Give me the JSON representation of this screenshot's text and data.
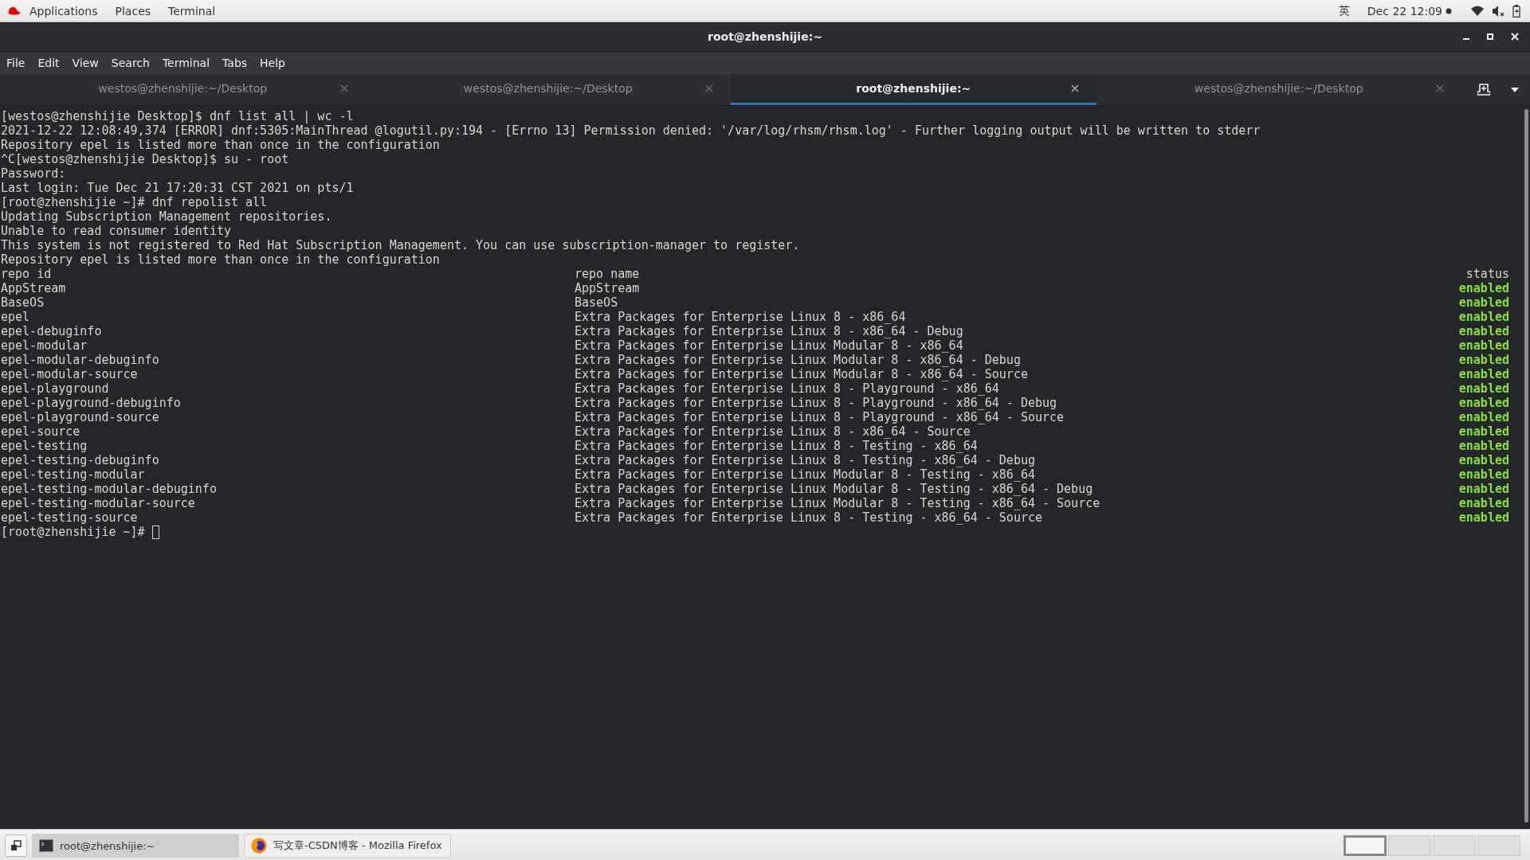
{
  "top_bar": {
    "menus": [
      "Applications",
      "Places",
      "Terminal"
    ],
    "input_method": "英",
    "clock": "Dec 22  12:09"
  },
  "window": {
    "title": "root@zhenshijie:~",
    "menu": [
      "File",
      "Edit",
      "View",
      "Search",
      "Terminal",
      "Tabs",
      "Help"
    ],
    "tabs": [
      {
        "label": "westos@zhenshijie:~/Desktop",
        "selected": false
      },
      {
        "label": "westos@zhenshijie:~/Desktop",
        "selected": false
      },
      {
        "label": "root@zhenshijie:~",
        "selected": true
      },
      {
        "label": "westos@zhenshijie:~/Desktop",
        "selected": false
      }
    ],
    "terminal": {
      "lines": [
        "[westos@zhenshijie Desktop]$ dnf list all | wc -l",
        "2021-12-22 12:08:49,374 [ERROR] dnf:5305:MainThread @logutil.py:194 - [Errno 13] Permission denied: '/var/log/rhsm/rhsm.log' - Further logging output will be written to stderr",
        "Repository epel is listed more than once in the configuration",
        "^C[westos@zhenshijie Desktop]$ su - root",
        "Password:",
        "Last login: Tue Dec 21 17:20:31 CST 2021 on pts/1",
        "[root@zhenshijie ~]# dnf repolist all",
        "Updating Subscription Management repositories.",
        "Unable to read consumer identity",
        "This system is not registered to Red Hat Subscription Management. You can use subscription-manager to register.",
        "Repository epel is listed more than once in the configuration"
      ],
      "repo_table": {
        "columns": [
          "repo id",
          "repo name",
          "status"
        ],
        "rows": [
          {
            "id": "AppStream",
            "name": "AppStream",
            "status": "enabled"
          },
          {
            "id": "BaseOS",
            "name": "BaseOS",
            "status": "enabled"
          },
          {
            "id": "epel",
            "name": "Extra Packages for Enterprise Linux 8 - x86_64",
            "status": "enabled"
          },
          {
            "id": "epel-debuginfo",
            "name": "Extra Packages for Enterprise Linux 8 - x86_64 - Debug",
            "status": "enabled"
          },
          {
            "id": "epel-modular",
            "name": "Extra Packages for Enterprise Linux Modular 8 - x86_64",
            "status": "enabled"
          },
          {
            "id": "epel-modular-debuginfo",
            "name": "Extra Packages for Enterprise Linux Modular 8 - x86_64 - Debug",
            "status": "enabled"
          },
          {
            "id": "epel-modular-source",
            "name": "Extra Packages for Enterprise Linux Modular 8 - x86_64 - Source",
            "status": "enabled"
          },
          {
            "id": "epel-playground",
            "name": "Extra Packages for Enterprise Linux 8 - Playground - x86_64",
            "status": "enabled"
          },
          {
            "id": "epel-playground-debuginfo",
            "name": "Extra Packages for Enterprise Linux 8 - Playground - x86_64 - Debug",
            "status": "enabled"
          },
          {
            "id": "epel-playground-source",
            "name": "Extra Packages for Enterprise Linux 8 - Playground - x86_64 - Source",
            "status": "enabled"
          },
          {
            "id": "epel-source",
            "name": "Extra Packages for Enterprise Linux 8 - x86_64 - Source",
            "status": "enabled"
          },
          {
            "id": "epel-testing",
            "name": "Extra Packages for Enterprise Linux 8 - Testing - x86_64",
            "status": "enabled"
          },
          {
            "id": "epel-testing-debuginfo",
            "name": "Extra Packages for Enterprise Linux 8 - Testing - x86_64 - Debug",
            "status": "enabled"
          },
          {
            "id": "epel-testing-modular",
            "name": "Extra Packages for Enterprise Linux Modular 8 - Testing - x86_64",
            "status": "enabled"
          },
          {
            "id": "epel-testing-modular-debuginfo",
            "name": "Extra Packages for Enterprise Linux Modular 8 - Testing - x86_64 - Debug",
            "status": "enabled"
          },
          {
            "id": "epel-testing-modular-source",
            "name": "Extra Packages for Enterprise Linux Modular 8 - Testing - x86_64 - Source",
            "status": "enabled"
          },
          {
            "id": "epel-testing-source",
            "name": "Extra Packages for Enterprise Linux 8 - Testing - x86_64 - Source",
            "status": "enabled"
          }
        ]
      },
      "prompt": "[root@zhenshijie ~]#"
    }
  },
  "taskbar": {
    "items": [
      {
        "kind": "terminal",
        "label": "root@zhenshijie:~",
        "selected": true
      },
      {
        "kind": "browser",
        "label": "写文章-CSDN博客 - Mozilla Firefox",
        "selected": false
      }
    ],
    "workspaces": [
      {
        "selected": true
      },
      {
        "selected": false
      },
      {
        "selected": false
      },
      {
        "selected": false
      }
    ]
  }
}
